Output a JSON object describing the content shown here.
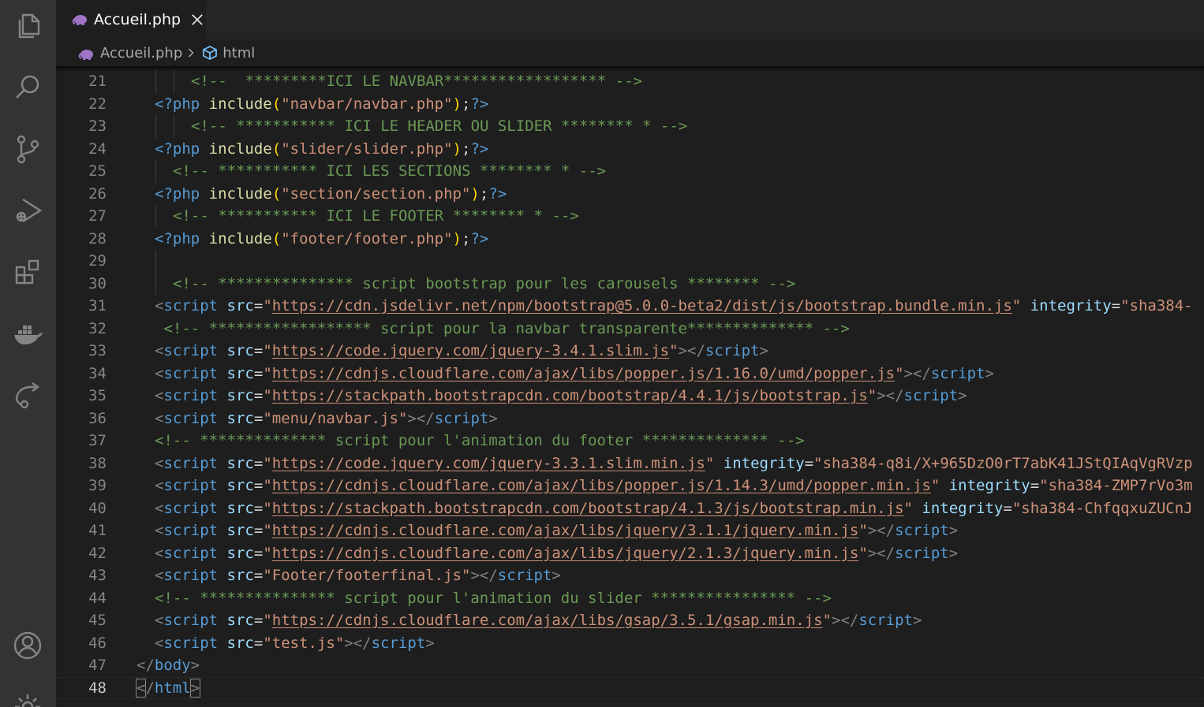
{
  "activity_bar": {
    "items": [
      {
        "name": "explorer",
        "icon": "files-icon"
      },
      {
        "name": "search",
        "icon": "search-icon"
      },
      {
        "name": "source-control",
        "icon": "source-control-icon"
      },
      {
        "name": "run-debug",
        "icon": "run-debug-icon"
      },
      {
        "name": "extensions",
        "icon": "extensions-icon"
      },
      {
        "name": "docker",
        "icon": "docker-icon"
      },
      {
        "name": "live-share",
        "icon": "live-share-icon"
      },
      {
        "name": "accounts",
        "icon": "account-icon"
      },
      {
        "name": "manage",
        "icon": "gear-icon"
      }
    ]
  },
  "tab": {
    "label": "Accueil.php",
    "icon": "php-elephant-icon",
    "close_icon": "close-icon"
  },
  "breadcrumb": {
    "file": "Accueil.php",
    "symbol": "html"
  },
  "colors": {
    "comment": "#6a9955",
    "keyword": "#569cd6",
    "function": "#dcdcaa",
    "bracket": "#ffd700",
    "string": "#ce9178",
    "attribute": "#9cdcfe",
    "punctuation": "#808080",
    "line_number": "#858585"
  },
  "lines": [
    {
      "n": "21",
      "indent": 3,
      "tokens": [
        [
          "cmt",
          "<!--  *********ICI LE NAVBAR****************** -->"
        ]
      ]
    },
    {
      "n": "22",
      "indent": 1,
      "tokens": [
        [
          "php",
          "<?php"
        ],
        [
          "pn",
          " "
        ],
        [
          "fn",
          "include"
        ],
        [
          "br",
          "("
        ],
        [
          "str",
          "\"navbar/navbar.php\""
        ],
        [
          "br",
          ")"
        ],
        [
          "pn",
          ";"
        ],
        [
          "php",
          "?>"
        ]
      ]
    },
    {
      "n": "23",
      "indent": 3,
      "tokens": [
        [
          "cmt",
          "<!-- *********** ICI LE HEADER OU SLIDER ******** * -->"
        ]
      ]
    },
    {
      "n": "24",
      "indent": 1,
      "tokens": [
        [
          "php",
          "<?php"
        ],
        [
          "pn",
          " "
        ],
        [
          "fn",
          "include"
        ],
        [
          "br",
          "("
        ],
        [
          "str",
          "\"slider/slider.php\""
        ],
        [
          "br",
          ")"
        ],
        [
          "pn",
          ";"
        ],
        [
          "php",
          "?>"
        ]
      ]
    },
    {
      "n": "25",
      "indent": 2,
      "tokens": [
        [
          "cmt",
          "<!-- *********** ICI LES SECTIONS ******** * -->"
        ]
      ]
    },
    {
      "n": "26",
      "indent": 1,
      "tokens": [
        [
          "php",
          "<?php"
        ],
        [
          "pn",
          " "
        ],
        [
          "fn",
          "include"
        ],
        [
          "br",
          "("
        ],
        [
          "str",
          "\"section/section.php\""
        ],
        [
          "br",
          ")"
        ],
        [
          "pn",
          ";"
        ],
        [
          "php",
          "?>"
        ]
      ]
    },
    {
      "n": "27",
      "indent": 2,
      "tokens": [
        [
          "cmt",
          "<!-- *********** ICI LE FOOTER ******** * -->"
        ]
      ]
    },
    {
      "n": "28",
      "indent": 1,
      "tokens": [
        [
          "php",
          "<?php"
        ],
        [
          "pn",
          " "
        ],
        [
          "fn",
          "include"
        ],
        [
          "br",
          "("
        ],
        [
          "str",
          "\"footer/footer.php\""
        ],
        [
          "br",
          ")"
        ],
        [
          "pn",
          ";"
        ],
        [
          "php",
          "?>"
        ]
      ]
    },
    {
      "n": "29",
      "indent": 2,
      "tokens": []
    },
    {
      "n": "30",
      "indent": 2,
      "tokens": [
        [
          "cmt",
          "<!-- *************** script bootstrap pour les carousels ******** -->"
        ]
      ]
    },
    {
      "n": "31",
      "indent": 1,
      "tokens": [
        [
          "gt",
          "<"
        ],
        [
          "tag",
          "script"
        ],
        [
          "pn",
          " "
        ],
        [
          "attr",
          "src"
        ],
        [
          "pn",
          "="
        ],
        [
          "str",
          "\""
        ],
        [
          "url",
          "https://cdn.jsdelivr.net/npm/bootstrap@5.0.0-beta2/dist/js/bootstrap.bundle.min.js"
        ],
        [
          "str",
          "\""
        ],
        [
          "pn",
          " "
        ],
        [
          "attr",
          "integrity"
        ],
        [
          "pn",
          "="
        ],
        [
          "str",
          "\"sha384-"
        ]
      ]
    },
    {
      "n": "32",
      "indent": 1,
      "lead": " ",
      "tokens": [
        [
          "cmt",
          "<!-- ****************** script pour la navbar transparente************** -->"
        ]
      ]
    },
    {
      "n": "33",
      "indent": 1,
      "tokens": [
        [
          "gt",
          "<"
        ],
        [
          "tag",
          "script"
        ],
        [
          "pn",
          " "
        ],
        [
          "attr",
          "src"
        ],
        [
          "pn",
          "="
        ],
        [
          "str",
          "\""
        ],
        [
          "url",
          "https://code.jquery.com/jquery-3.4.1.slim.js"
        ],
        [
          "str",
          "\""
        ],
        [
          "gt",
          "></"
        ],
        [
          "tag",
          "script"
        ],
        [
          "gt",
          ">"
        ]
      ]
    },
    {
      "n": "34",
      "indent": 1,
      "tokens": [
        [
          "gt",
          "<"
        ],
        [
          "tag",
          "script"
        ],
        [
          "pn",
          " "
        ],
        [
          "attr",
          "src"
        ],
        [
          "pn",
          "="
        ],
        [
          "str",
          "\""
        ],
        [
          "url",
          "https://cdnjs.cloudflare.com/ajax/libs/popper.js/1.16.0/umd/popper.js"
        ],
        [
          "str",
          "\""
        ],
        [
          "gt",
          "></"
        ],
        [
          "tag",
          "script"
        ],
        [
          "gt",
          ">"
        ]
      ]
    },
    {
      "n": "35",
      "indent": 1,
      "tokens": [
        [
          "gt",
          "<"
        ],
        [
          "tag",
          "script"
        ],
        [
          "pn",
          " "
        ],
        [
          "attr",
          "src"
        ],
        [
          "pn",
          "="
        ],
        [
          "str",
          "\""
        ],
        [
          "url",
          "https://stackpath.bootstrapcdn.com/bootstrap/4.4.1/js/bootstrap.js"
        ],
        [
          "str",
          "\""
        ],
        [
          "gt",
          "></"
        ],
        [
          "tag",
          "script"
        ],
        [
          "gt",
          ">"
        ]
      ]
    },
    {
      "n": "36",
      "indent": 1,
      "tokens": [
        [
          "gt",
          "<"
        ],
        [
          "tag",
          "script"
        ],
        [
          "pn",
          " "
        ],
        [
          "attr",
          "src"
        ],
        [
          "pn",
          "="
        ],
        [
          "str",
          "\"menu/navbar.js\""
        ],
        [
          "gt",
          "></"
        ],
        [
          "tag",
          "script"
        ],
        [
          "gt",
          ">"
        ]
      ]
    },
    {
      "n": "37",
      "indent": 1,
      "tokens": [
        [
          "cmt",
          "<!-- ************** script pour l'animation du footer ************** -->"
        ]
      ]
    },
    {
      "n": "38",
      "indent": 1,
      "tokens": [
        [
          "gt",
          "<"
        ],
        [
          "tag",
          "script"
        ],
        [
          "pn",
          " "
        ],
        [
          "attr",
          "src"
        ],
        [
          "pn",
          "="
        ],
        [
          "str",
          "\""
        ],
        [
          "url",
          "https://code.jquery.com/jquery-3.3.1.slim.min.js"
        ],
        [
          "str",
          "\""
        ],
        [
          "pn",
          " "
        ],
        [
          "attr",
          "integrity"
        ],
        [
          "pn",
          "="
        ],
        [
          "str",
          "\"sha384-q8i/X+965DzO0rT7abK41JStQIAqVgRVzp"
        ]
      ]
    },
    {
      "n": "39",
      "indent": 1,
      "tokens": [
        [
          "gt",
          "<"
        ],
        [
          "tag",
          "script"
        ],
        [
          "pn",
          " "
        ],
        [
          "attr",
          "src"
        ],
        [
          "pn",
          "="
        ],
        [
          "str",
          "\""
        ],
        [
          "url",
          "https://cdnjs.cloudflare.com/ajax/libs/popper.js/1.14.3/umd/popper.min.js"
        ],
        [
          "str",
          "\""
        ],
        [
          "pn",
          " "
        ],
        [
          "attr",
          "integrity"
        ],
        [
          "pn",
          "="
        ],
        [
          "str",
          "\"sha384-ZMP7rVo3m"
        ]
      ]
    },
    {
      "n": "40",
      "indent": 1,
      "tokens": [
        [
          "gt",
          "<"
        ],
        [
          "tag",
          "script"
        ],
        [
          "pn",
          " "
        ],
        [
          "attr",
          "src"
        ],
        [
          "pn",
          "="
        ],
        [
          "str",
          "\""
        ],
        [
          "url",
          "https://stackpath.bootstrapcdn.com/bootstrap/4.1.3/js/bootstrap.min.js"
        ],
        [
          "str",
          "\""
        ],
        [
          "pn",
          " "
        ],
        [
          "attr",
          "integrity"
        ],
        [
          "pn",
          "="
        ],
        [
          "str",
          "\"sha384-ChfqqxuZUCnJ"
        ]
      ]
    },
    {
      "n": "41",
      "indent": 1,
      "tokens": [
        [
          "gt",
          "<"
        ],
        [
          "tag",
          "script"
        ],
        [
          "pn",
          " "
        ],
        [
          "attr",
          "src"
        ],
        [
          "pn",
          "="
        ],
        [
          "str",
          "\""
        ],
        [
          "url",
          "https://cdnjs.cloudflare.com/ajax/libs/jquery/3.1.1/jquery.min.js"
        ],
        [
          "str",
          "\""
        ],
        [
          "gt",
          "></"
        ],
        [
          "tag",
          "script"
        ],
        [
          "gt",
          ">"
        ]
      ]
    },
    {
      "n": "42",
      "indent": 1,
      "tokens": [
        [
          "gt",
          "<"
        ],
        [
          "tag",
          "script"
        ],
        [
          "pn",
          " "
        ],
        [
          "attr",
          "src"
        ],
        [
          "pn",
          "="
        ],
        [
          "str",
          "\""
        ],
        [
          "url",
          "https://cdnjs.cloudflare.com/ajax/libs/jquery/2.1.3/jquery.min.js"
        ],
        [
          "str",
          "\""
        ],
        [
          "gt",
          "></"
        ],
        [
          "tag",
          "script"
        ],
        [
          "gt",
          ">"
        ]
      ]
    },
    {
      "n": "43",
      "indent": 1,
      "tokens": [
        [
          "gt",
          "<"
        ],
        [
          "tag",
          "script"
        ],
        [
          "pn",
          " "
        ],
        [
          "attr",
          "src"
        ],
        [
          "pn",
          "="
        ],
        [
          "str",
          "\"Footer/footerfinal.js\""
        ],
        [
          "gt",
          "></"
        ],
        [
          "tag",
          "script"
        ],
        [
          "gt",
          ">"
        ]
      ]
    },
    {
      "n": "44",
      "indent": 1,
      "tokens": [
        [
          "cmt",
          "<!-- *************** script pour l'animation du slider **************** -->"
        ]
      ]
    },
    {
      "n": "45",
      "indent": 1,
      "tokens": [
        [
          "gt",
          "<"
        ],
        [
          "tag",
          "script"
        ],
        [
          "pn",
          " "
        ],
        [
          "attr",
          "src"
        ],
        [
          "pn",
          "="
        ],
        [
          "str",
          "\""
        ],
        [
          "url",
          "https://cdnjs.cloudflare.com/ajax/libs/gsap/3.5.1/gsap.min.js"
        ],
        [
          "str",
          "\""
        ],
        [
          "gt",
          "></"
        ],
        [
          "tag",
          "script"
        ],
        [
          "gt",
          ">"
        ]
      ]
    },
    {
      "n": "46",
      "indent": 1,
      "tokens": [
        [
          "gt",
          "<"
        ],
        [
          "tag",
          "script"
        ],
        [
          "pn",
          " "
        ],
        [
          "attr",
          "src"
        ],
        [
          "pn",
          "="
        ],
        [
          "str",
          "\"test.js\""
        ],
        [
          "gt",
          "></"
        ],
        [
          "tag",
          "script"
        ],
        [
          "gt",
          ">"
        ]
      ]
    },
    {
      "n": "47",
      "indent": 0,
      "tokens": [
        [
          "gt",
          "</"
        ],
        [
          "tag",
          "body"
        ],
        [
          "gt",
          ">"
        ]
      ]
    },
    {
      "n": "48",
      "indent": 0,
      "current": true,
      "tokens": [
        [
          "cursor",
          "<"
        ],
        [
          "gt",
          "/"
        ],
        [
          "tag",
          "html"
        ],
        [
          "cursor",
          ">"
        ]
      ]
    }
  ]
}
